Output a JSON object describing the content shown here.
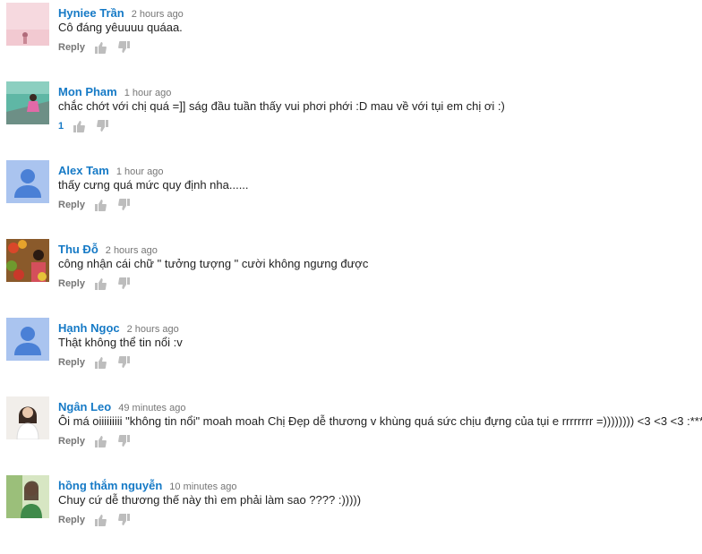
{
  "comments": [
    {
      "author": "Hyniee Trần",
      "time": "2 hours ago",
      "text": "Cô đáng yêuuuu quáaa.",
      "reply": "Reply",
      "likes": "",
      "avatar": "pink-photo"
    },
    {
      "author": "Mon Pham",
      "time": "1 hour ago",
      "text": "chắc chớt với chị quá =]] ság đầu tuần thấy vui phơi phới :D mau về với tụi em chị ơi :)",
      "reply": "",
      "likes": "1",
      "avatar": "boat-photo"
    },
    {
      "author": "Alex Tam",
      "time": "1 hour ago",
      "text": "thấy cưng quá mức quy định nha......",
      "reply": "Reply",
      "likes": "",
      "avatar": "default-user"
    },
    {
      "author": "Thu Đỗ",
      "time": "2 hours ago",
      "text": "công nhận cái chữ \" tưởng tượng \" cười không ngưng được",
      "reply": "Reply",
      "likes": "",
      "avatar": "food-photo"
    },
    {
      "author": "Hạnh Ngọc",
      "time": "2 hours ago",
      "text": "Thật không thể tin nổi :v",
      "reply": "Reply",
      "likes": "",
      "avatar": "default-user"
    },
    {
      "author": "Ngân Leo",
      "time": "49 minutes ago",
      "text": "Ôi má oiiiiiiiii \"không tin nổi\" moah moah Chị Đẹp dễ thương v khùng quá sức chịu đựng của tụi e rrrrrrrr =)))))))) <3 <3 <3 :***",
      "reply": "Reply",
      "likes": "",
      "avatar": "portrait-photo"
    },
    {
      "author": "hồng thắm nguyễn",
      "time": "10 minutes ago",
      "text": "Chuy cứ dễ thương thế này thì em phải làm sao ???? :)))))",
      "reply": "Reply",
      "likes": "",
      "avatar": "green-photo"
    }
  ]
}
